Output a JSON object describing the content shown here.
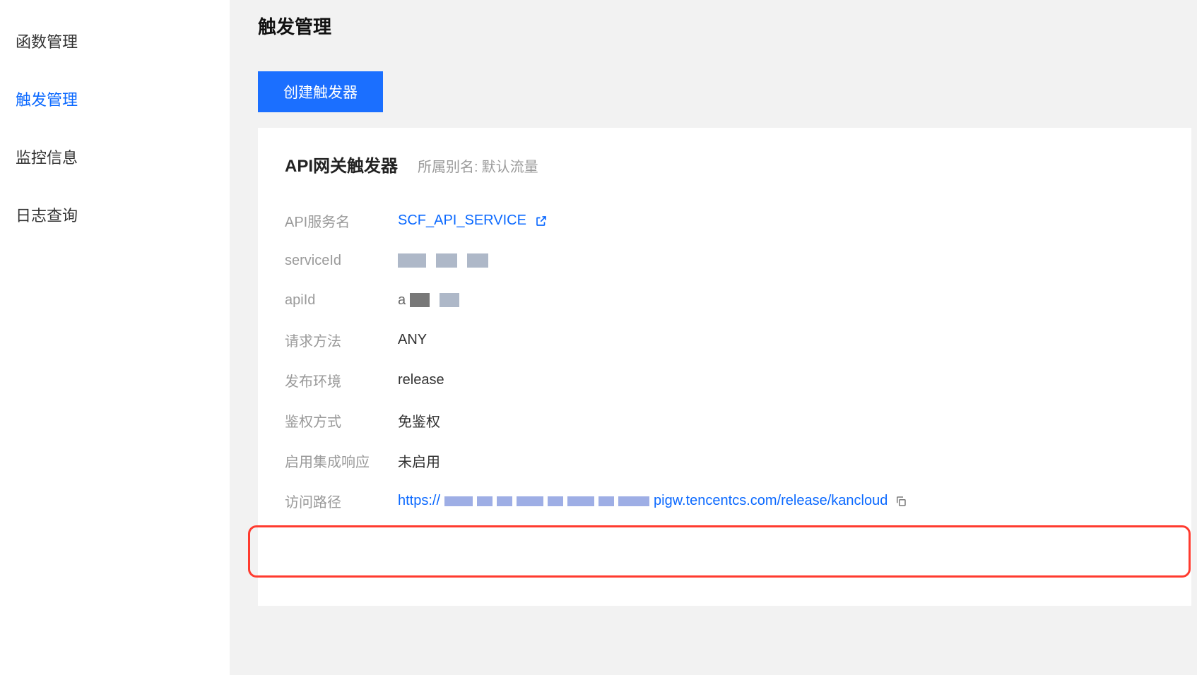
{
  "sidebar": {
    "items": [
      {
        "label": "函数管理",
        "active": false
      },
      {
        "label": "触发管理",
        "active": true
      },
      {
        "label": "监控信息",
        "active": false
      },
      {
        "label": "日志查询",
        "active": false
      }
    ]
  },
  "page": {
    "title": "触发管理"
  },
  "buttons": {
    "create": "创建触发器"
  },
  "panel": {
    "triggerType": "API网关触发器",
    "aliasLabel": "所属别名:",
    "aliasValue": "默认流量",
    "fields": {
      "apiServiceName": {
        "label": "API服务名",
        "value": "SCF_API_SERVICE"
      },
      "serviceId": {
        "label": "serviceId",
        "value": ""
      },
      "apiId": {
        "label": "apiId",
        "value": ""
      },
      "requestMethod": {
        "label": "请求方法",
        "value": "ANY"
      },
      "publishEnv": {
        "label": "发布环境",
        "value": "release"
      },
      "authType": {
        "label": "鉴权方式",
        "value": "免鉴权"
      },
      "integratedResp": {
        "label": "启用集成响应",
        "value": "未启用"
      },
      "accessPath": {
        "label": "访问路径",
        "prefix": "https://",
        "suffix": "pigw.tencentcs.com/release/kancloud"
      }
    }
  }
}
